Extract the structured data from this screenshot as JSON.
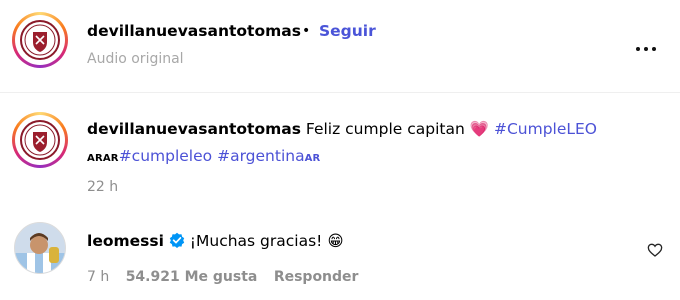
{
  "header": {
    "username": "devillanuevasantotomas",
    "dot": "•",
    "follow_label": "Seguir",
    "audio_label": "Audio original",
    "more_icon": "more-horizontal-icon"
  },
  "post_caption": {
    "username": "devillanuevasantotomas",
    "text": "Feliz cumple capitan",
    "heart_emoji": "💗",
    "hashtag_1": "#CumpleLEO",
    "prefix_tag": "ARAR",
    "hashtag_2": "#cumpleleo",
    "hashtag_3": "#argentina",
    "suffix_tag": "AR",
    "time": "22 h"
  },
  "comment": {
    "username": "leomessi",
    "verified_icon": "verified-badge-icon",
    "text": "¡Muchas gracias!",
    "emoji": "😁",
    "time": "7 h",
    "likes": "54.921 Me gusta",
    "reply_label": "Responder",
    "like_icon": "heart-outline-icon"
  },
  "colors": {
    "link": "#4c52d6",
    "muted": "#8e8e8e",
    "verified": "#0095f6"
  }
}
